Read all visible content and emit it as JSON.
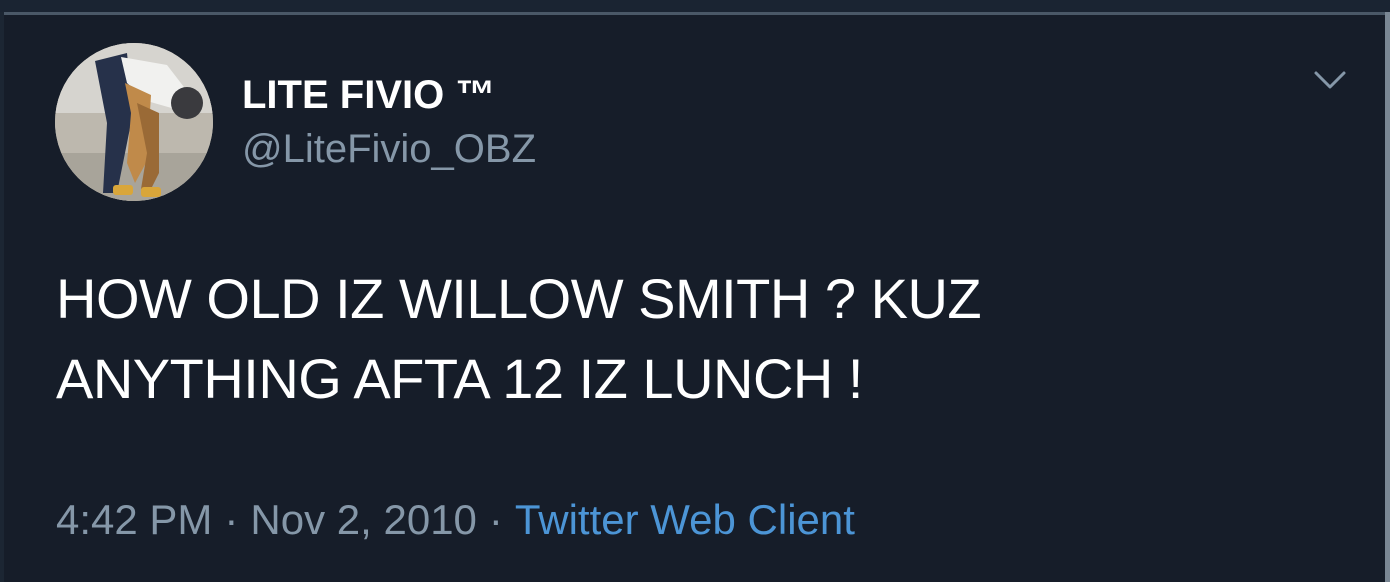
{
  "tweet": {
    "display_name": "LITE FIVIO ™",
    "handle": "@LiteFivio_OBZ",
    "text": "HOW OLD IZ WILLOW SMITH ? KUZ\nANYTHING AFTA 12 IZ LUNCH !",
    "time": "4:42 PM",
    "separator": "·",
    "date": "Nov 2, 2010",
    "source": "Twitter Web Client"
  },
  "icons": {
    "more": "chevron-down-icon",
    "avatar": "avatar"
  },
  "colors": {
    "background": "#161d29",
    "text": "#ffffff",
    "secondary_text": "#8597a8",
    "link": "#4c95d6"
  }
}
